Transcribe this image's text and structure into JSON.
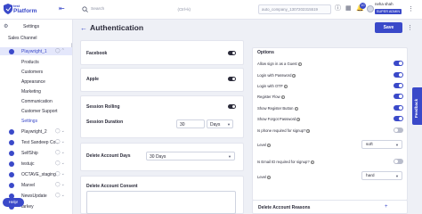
{
  "brand": {
    "line1": "test",
    "line2": "Platform",
    "accent": "#3a49c9"
  },
  "topbar": {
    "search_placeholder": "Search",
    "search_shortcut": "(Ctrl+k)",
    "company": "auto_company_1307202315519",
    "notifications_count": "10",
    "user_name": "neha shah",
    "user_role": "SUPER ADMIN"
  },
  "sidebar": {
    "settings_label": "Settings",
    "sales_channel_label": "Sales Channel",
    "active_store": "Playwright_1",
    "sub_items": [
      "Products",
      "Customers",
      "Appearance",
      "Marketing",
      "Communication",
      "Customer Support",
      "Settings"
    ],
    "stores": [
      "Playwright_2",
      "Test Sandeep Co...",
      "SelfShip",
      "testujc",
      "OCTAVE_staging",
      "Marvel",
      "NewsUpdate",
      "tarkey"
    ],
    "help_label": "Help!"
  },
  "page": {
    "title": "Authentication",
    "save_label": "Save"
  },
  "left": {
    "facebook": "Facebook",
    "apple": "Apple",
    "session_rolling": "Session Rolling",
    "session_duration": "Session Duration",
    "session_duration_value": "30",
    "session_duration_unit": "Days",
    "delete_account_days": "Delete Account Days",
    "delete_account_days_value": "30 Days",
    "delete_account_consent": "Delete Account Consent"
  },
  "options": {
    "title": "Options",
    "toggles": [
      {
        "label": "Allow sign in as a Guest",
        "on": true
      },
      {
        "label": "Login with Password",
        "on": true
      },
      {
        "label": "Login with OTP",
        "on": true
      },
      {
        "label": "Register Flow",
        "on": true
      },
      {
        "label": "Show Register Button",
        "on": true
      },
      {
        "label": "Show Forgot Password",
        "on": true
      },
      {
        "label": "Is phone required for signup?",
        "on": false
      }
    ],
    "level1_label": "Level",
    "level1_value": "soft",
    "email_required_label": "Is Email ID required for signup?",
    "email_required_on": false,
    "level2_label": "Level",
    "level2_value": "hard",
    "delete_account_reasons": "Delete Account Reasons",
    "add_icon": "plus"
  },
  "feedback_label": "Feedback"
}
